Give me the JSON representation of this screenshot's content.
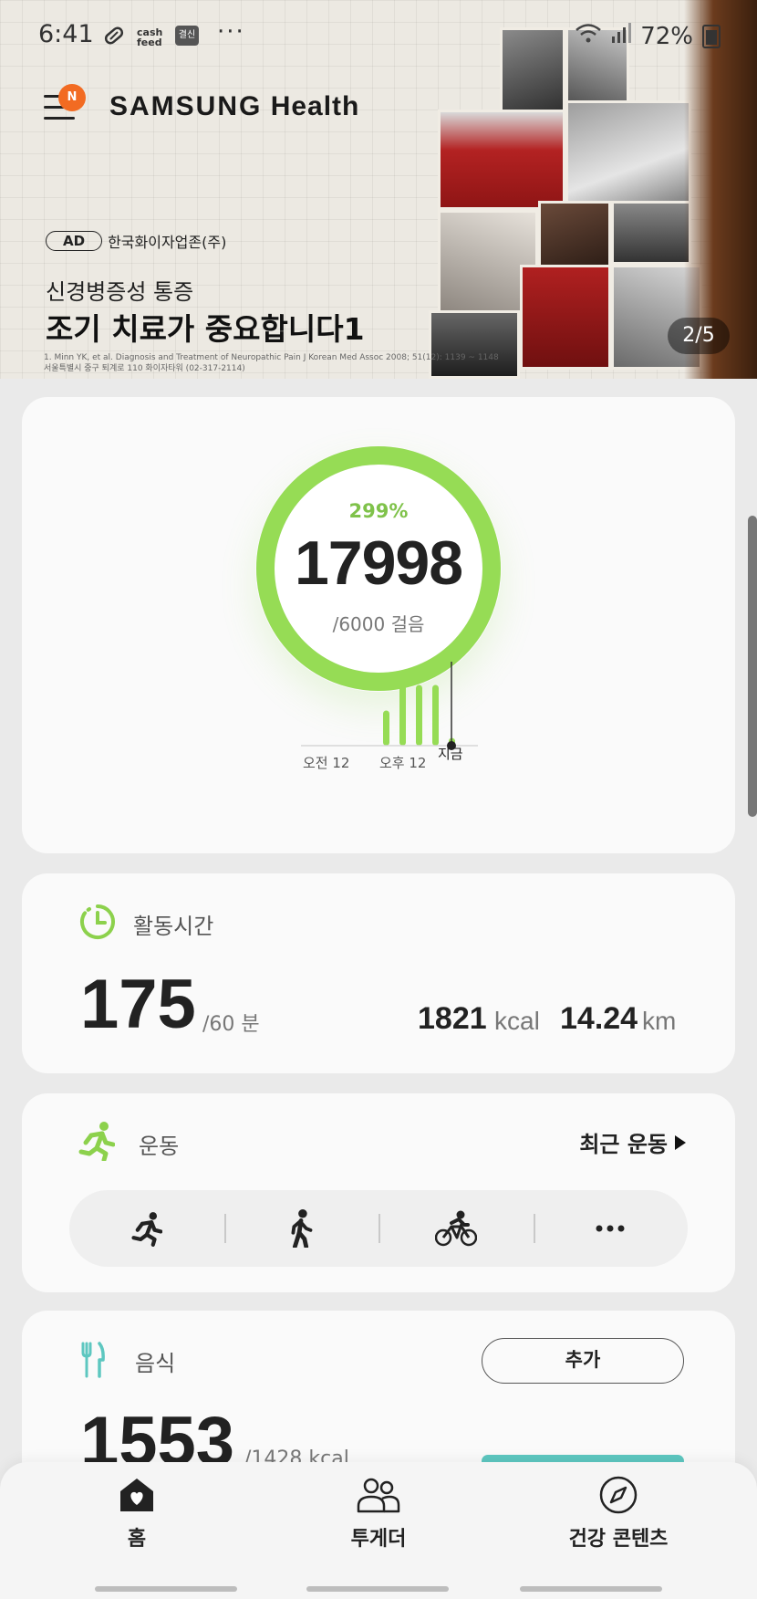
{
  "status_bar": {
    "time": "6:41",
    "icons": [
      "pill-icon",
      "cashfeed-icon",
      "app-icon",
      "more-dots-icon",
      "wifi-icon",
      "signal-icon",
      "battery-icon"
    ],
    "cashfeed_label": "cash feed",
    "app_label": "결신",
    "battery_percent": "72%"
  },
  "banner": {
    "brand": "SAMSUNG Health",
    "brand_primary": "SAMSUNG",
    "brand_secondary": "Health",
    "notification_badge": "N",
    "ad_badge": "AD",
    "ad_sponsor": "한국화이자업존(주)",
    "ad_subtitle": "신경병증성 통증",
    "ad_title": "조기 치료가 중요합니다1",
    "ad_fine_line1": "1. Minn YK, et al. Diagnosis and Treatment of Neuropathic Pain J Korean Med Assoc 2008; 51(12): 1139 ~ 1148",
    "ad_fine_line2": "서울특별시 중구 퇴계로 110 화이자타워 (02-317-2114)",
    "page_indicator": "2/5"
  },
  "steps": {
    "percent_label": "299%",
    "count": "17998",
    "goal_label": "/6000 걸음",
    "progress_fraction": 1.0,
    "hist_labels": [
      "오전 12",
      "오후 12",
      "지금"
    ],
    "hist_bars": [
      0.55,
      0.95,
      0.95,
      0.95,
      0.12
    ],
    "accent_color": "#96dc55"
  },
  "activity": {
    "title": "활동시간",
    "minutes": "175",
    "goal_label": "/60 분",
    "kcal_value": "1821",
    "kcal_unit": "kcal",
    "km_value": "14.24",
    "km_unit": "km"
  },
  "exercise": {
    "title": "운동",
    "recent_label": "최근 운동",
    "buttons": [
      "running-icon",
      "walking-icon",
      "cycling-icon",
      "more-icon"
    ]
  },
  "food": {
    "title": "음식",
    "add_label": "추가",
    "value": "1553",
    "goal_label": "/1428 kcal",
    "bar_color": "#5dc7c0"
  },
  "nav": {
    "items": [
      {
        "label": "홈",
        "icon": "home-icon"
      },
      {
        "label": "투게더",
        "icon": "together-icon"
      },
      {
        "label": "건강 콘텐츠",
        "icon": "compass-icon"
      }
    ]
  }
}
